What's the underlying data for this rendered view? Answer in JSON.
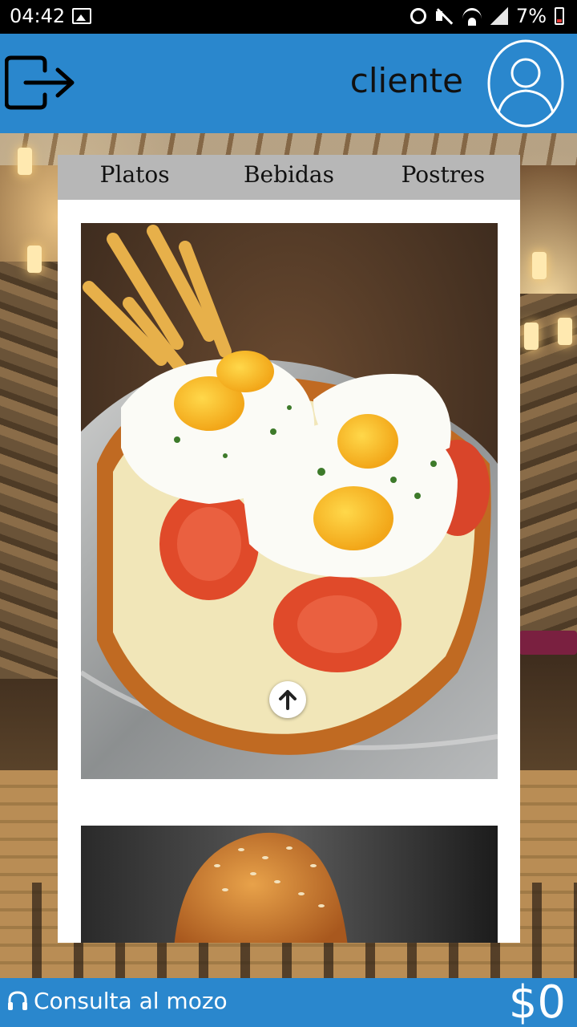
{
  "status_bar": {
    "time": "04:42",
    "battery": "7%"
  },
  "header": {
    "title": "cliente"
  },
  "tabs": [
    {
      "label": "Platos"
    },
    {
      "label": "Bebidas"
    },
    {
      "label": "Postres"
    }
  ],
  "footer": {
    "consult_label": "Consulta al mozo",
    "total": "$0"
  },
  "colors": {
    "accent": "#2a87cd",
    "tab_bar": "#b7b7b7"
  }
}
